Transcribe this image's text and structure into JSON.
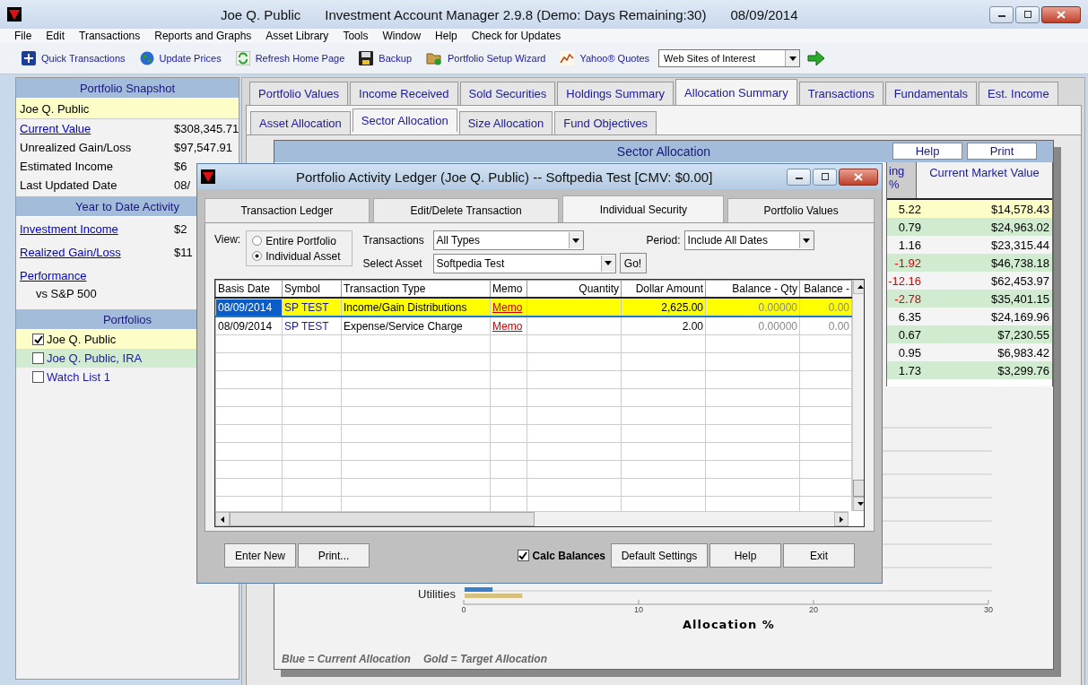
{
  "window": {
    "title": "Joe Q. Public",
    "app": "Investment Account Manager 2.9.8 (Demo: Days Remaining:30)",
    "date": "08/09/2014"
  },
  "menu": [
    "File",
    "Edit",
    "Transactions",
    "Reports and Graphs",
    "Asset Library",
    "Tools",
    "Window",
    "Help",
    "Check for Updates"
  ],
  "toolbar": {
    "buttons": [
      {
        "label": "Quick Transactions",
        "kind": "plus"
      },
      {
        "label": "Update Prices",
        "kind": "globe"
      },
      {
        "label": "Refresh Home Page",
        "kind": "refresh"
      },
      {
        "label": "Backup",
        "kind": "disk"
      },
      {
        "label": "Portfolio Setup Wizard",
        "kind": "folder"
      },
      {
        "label": "Yahoo® Quotes",
        "kind": "chart"
      }
    ],
    "combo": "Web Sites of Interest"
  },
  "snapshot": {
    "title": "Portfolio Snapshot",
    "owner": "Joe Q. Public",
    "rows": [
      {
        "label": "Current Value",
        "value": "$308,345.71",
        "link": true
      },
      {
        "label": "Unrealized Gain/Loss",
        "value": "$97,547.91",
        "link": false
      },
      {
        "label": "Estimated Income",
        "value": "$6",
        "link": false
      },
      {
        "label": "Last Updated Date",
        "value": "08/",
        "link": false
      }
    ]
  },
  "ytd": {
    "title": "Year to Date Activity",
    "rows": [
      {
        "label": "Investment Income",
        "value": "$2",
        "link": true
      },
      {
        "label": "Realized Gain/Loss",
        "value": "$11",
        "link": true
      },
      {
        "label": "Performance",
        "value": "",
        "link": true
      }
    ],
    "note": "vs S&P 500"
  },
  "portfolios": {
    "title": "Portfolios",
    "items": [
      {
        "label": "Joe Q. Public",
        "checked": true,
        "selected": true
      },
      {
        "label": "Joe Q. Public, IRA",
        "checked": false,
        "selected": false
      },
      {
        "label": "Watch List 1",
        "checked": false,
        "selected": false
      }
    ]
  },
  "tabs": [
    {
      "label": "Portfolio Values",
      "selected": false
    },
    {
      "label": "Income Received",
      "selected": false
    },
    {
      "label": "Sold Securities",
      "selected": false
    },
    {
      "label": "Holdings Summary",
      "selected": false
    },
    {
      "label": "Allocation Summary",
      "selected": true
    },
    {
      "label": "Transactions",
      "selected": false
    },
    {
      "label": "Fundamentals",
      "selected": false
    },
    {
      "label": "Est. Income",
      "selected": false
    }
  ],
  "subtabs": [
    {
      "label": "Asset Allocation",
      "selected": false
    },
    {
      "label": "Sector Allocation",
      "selected": true
    },
    {
      "label": "Size Allocation",
      "selected": false
    },
    {
      "label": "Fund Objectives",
      "selected": false
    }
  ],
  "sector": {
    "title": "Sector Allocation",
    "buttons": [
      "Help",
      "Print"
    ],
    "columns": [
      "ing %",
      "Current Market Value"
    ],
    "rows": [
      {
        "change": "5.22",
        "value": "$14,578.43",
        "negative": false,
        "selected": true
      },
      {
        "change": "0.79",
        "value": "$24,963.02",
        "negative": false,
        "selected": false
      },
      {
        "change": "1.16",
        "value": "$23,315.44",
        "negative": false,
        "selected": false
      },
      {
        "change": "-1.92",
        "value": "$46,738.18",
        "negative": true,
        "selected": false
      },
      {
        "change": "-12.16",
        "value": "$62,453.97",
        "negative": true,
        "selected": false
      },
      {
        "change": "-2.78",
        "value": "$35,401.15",
        "negative": true,
        "selected": false
      },
      {
        "change": "6.35",
        "value": "$24,169.96",
        "negative": false,
        "selected": false
      },
      {
        "change": "0.67",
        "value": "$7,230.55",
        "negative": false,
        "selected": false
      },
      {
        "change": "0.95",
        "value": "$6,983.42",
        "negative": false,
        "selected": false
      },
      {
        "change": "1.73",
        "value": "$3,299.76",
        "negative": false,
        "selected": false
      }
    ],
    "chart_data": {
      "type": "bar",
      "orientation": "horizontal",
      "xlabel": "Allocation %",
      "categories": [
        "Utilities"
      ],
      "series": [
        {
          "name": "Current Allocation",
          "color": "#3a7fc8",
          "values": [
            1.6
          ]
        },
        {
          "name": "Target Allocation",
          "color": "#d6c07e",
          "values": [
            3.3
          ]
        }
      ],
      "xlim": [
        0,
        30
      ],
      "xticks": [
        0,
        10,
        20,
        30
      ]
    },
    "legend_keys": [
      "Blue =",
      "Gold ="
    ]
  },
  "dialog": {
    "title": "Portfolio Activity Ledger (Joe Q. Public) -- Softpedia Test  [CMV: $0.00]",
    "tabs": [
      {
        "label": "Transaction Ledger",
        "selected": false
      },
      {
        "label": "Edit/Delete Transaction",
        "selected": false
      },
      {
        "label": "Individual Security",
        "selected": true
      },
      {
        "label": "Portfolio Values",
        "selected": false
      }
    ],
    "view_label": "View:",
    "view_options": [
      {
        "label": "Entire Portfolio",
        "selected": false
      },
      {
        "label": "Individual Asset",
        "selected": true
      }
    ],
    "transactions_label": "Transactions",
    "transactions_value": "All Types",
    "asset_label": "Select Asset",
    "asset_value": "Softpedia Test",
    "go": "Go!",
    "period_label": "Period:",
    "period_value": "Include All Dates",
    "columns": [
      "Basis Date",
      "Symbol",
      "Transaction Type",
      "Memo",
      "Quantity",
      "Dollar Amount",
      "Balance - Qty",
      "Balance -"
    ],
    "rows": [
      {
        "date": "08/09/2014",
        "symbol": "SP TEST",
        "type": "Income/Gain Distributions",
        "memo": "Memo",
        "amount": "2,625.00",
        "balance_qty": "0.00000",
        "balance": "0.00",
        "selected": true
      },
      {
        "date": "08/09/2014",
        "symbol": "SP TEST",
        "type": "Expense/Service Charge",
        "memo": "Memo",
        "amount": "2.00",
        "balance_qty": "0.00000",
        "balance": "0.00",
        "selected": false
      }
    ],
    "buttons_left": [
      "Enter New",
      "Print..."
    ],
    "calc": {
      "label": "Calc Balances",
      "checked": true
    },
    "buttons_right": [
      "Default Settings",
      "Help",
      "Exit"
    ]
  }
}
